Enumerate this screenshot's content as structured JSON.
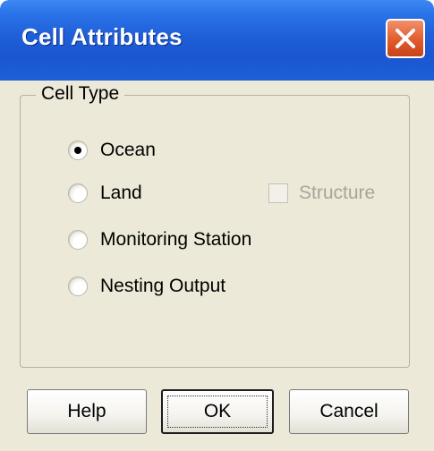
{
  "window": {
    "title": "Cell Attributes",
    "close_icon": "close-icon",
    "colors": {
      "titlebar": "#1f5fd8",
      "close_button": "#e25a2c",
      "dialog_bg": "#ece9d8"
    }
  },
  "cell_type": {
    "legend": "Cell Type",
    "options": [
      {
        "label": "Ocean",
        "checked": true
      },
      {
        "label": "Land",
        "checked": false
      },
      {
        "label": "Monitoring Station",
        "checked": false
      },
      {
        "label": "Nesting Output",
        "checked": false
      }
    ],
    "structure": {
      "label": "Structure",
      "checked": false,
      "enabled": false
    }
  },
  "buttons": {
    "help": "Help",
    "ok": "OK",
    "cancel": "Cancel"
  }
}
